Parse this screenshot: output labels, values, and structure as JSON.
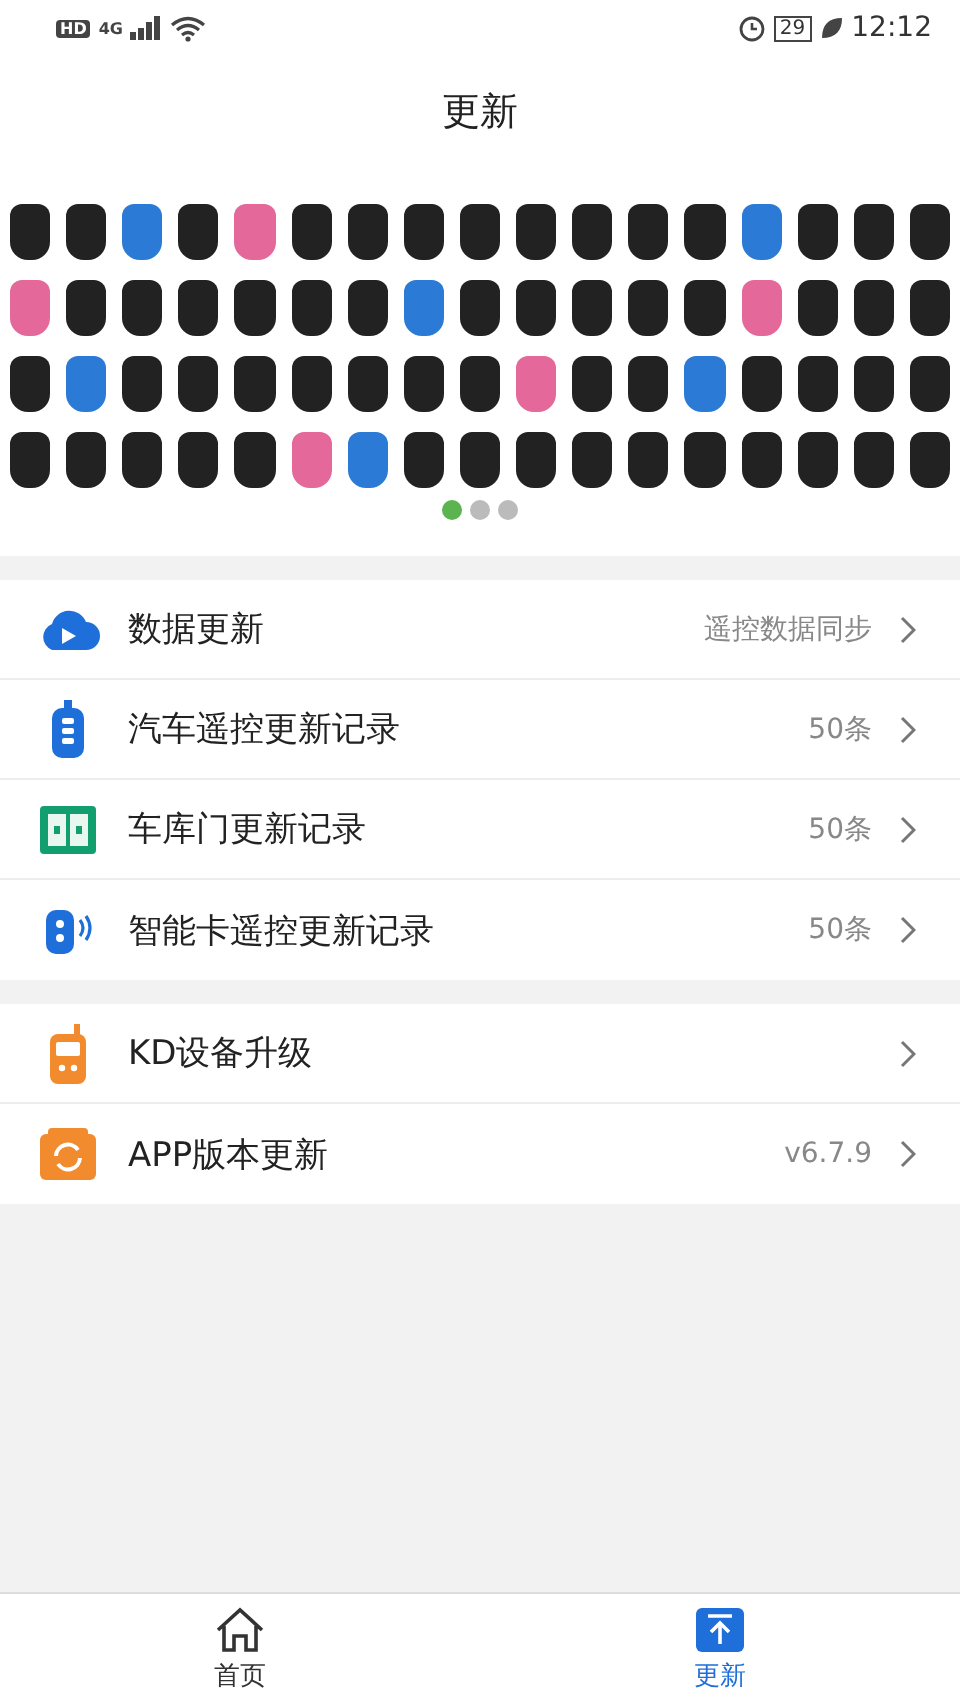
{
  "status_bar": {
    "hd": "HD",
    "network": "4G",
    "battery": "29",
    "time": "12:12"
  },
  "header": {
    "title": "更新"
  },
  "banner": {
    "dots": [
      {
        "selected": true
      },
      {
        "selected": false
      },
      {
        "selected": false
      }
    ]
  },
  "groups": [
    {
      "rows": [
        {
          "kind": "cloud",
          "title": "数据更新",
          "value": "遥控数据同步"
        },
        {
          "kind": "remote",
          "title": "汽车遥控更新记录",
          "value": "50条"
        },
        {
          "kind": "garage",
          "title": "车库门更新记录",
          "value": "50条"
        },
        {
          "kind": "smartkey",
          "title": "智能卡遥控更新记录",
          "value": "50条"
        }
      ]
    },
    {
      "rows": [
        {
          "kind": "device",
          "title": "KD设备升级"
        },
        {
          "kind": "app",
          "title": "APP版本更新",
          "value": "v6.7.9"
        }
      ]
    }
  ],
  "tabs": [
    {
      "label": "首页",
      "kind": "home",
      "selected": false
    },
    {
      "label": "更新",
      "kind": "upload",
      "selected": true
    }
  ]
}
